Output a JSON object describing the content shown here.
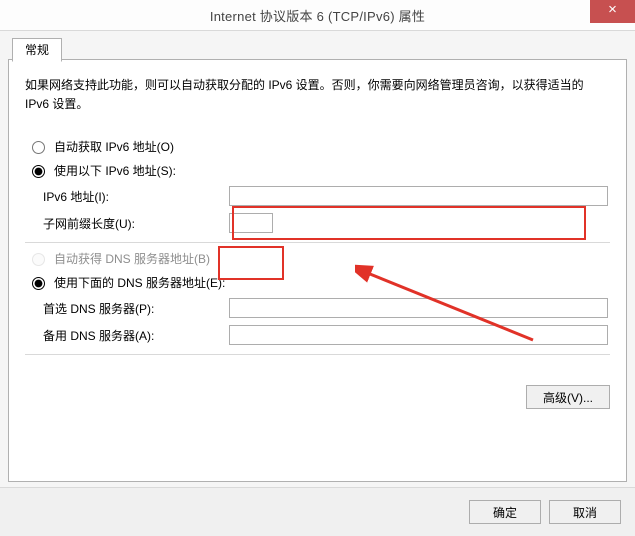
{
  "window": {
    "title": "Internet 协议版本 6 (TCP/IPv6) 属性",
    "closeGlyph": "×"
  },
  "tab": {
    "general": "常规"
  },
  "intro": "如果网络支持此功能，则可以自动获取分配的 IPv6 设置。否则，你需要向网络管理员咨询，以获得适当的 IPv6 设置。",
  "radios": {
    "auto_addr": "自动获取 IPv6 地址(O)",
    "manual_addr": "使用以下 IPv6 地址(S):",
    "auto_dns": "自动获得 DNS 服务器地址(B)",
    "manual_dns": "使用下面的 DNS 服务器地址(E):"
  },
  "fields": {
    "ipv6": {
      "label": "IPv6 地址(I):",
      "value": ""
    },
    "prefix": {
      "label": "子网前缀长度(U):",
      "value": ""
    },
    "dns1": {
      "label": "首选 DNS 服务器(P):",
      "value": ""
    },
    "dns2": {
      "label": "备用 DNS 服务器(A):",
      "value": ""
    }
  },
  "buttons": {
    "advanced": "高级(V)...",
    "ok": "确定",
    "cancel": "取消"
  }
}
